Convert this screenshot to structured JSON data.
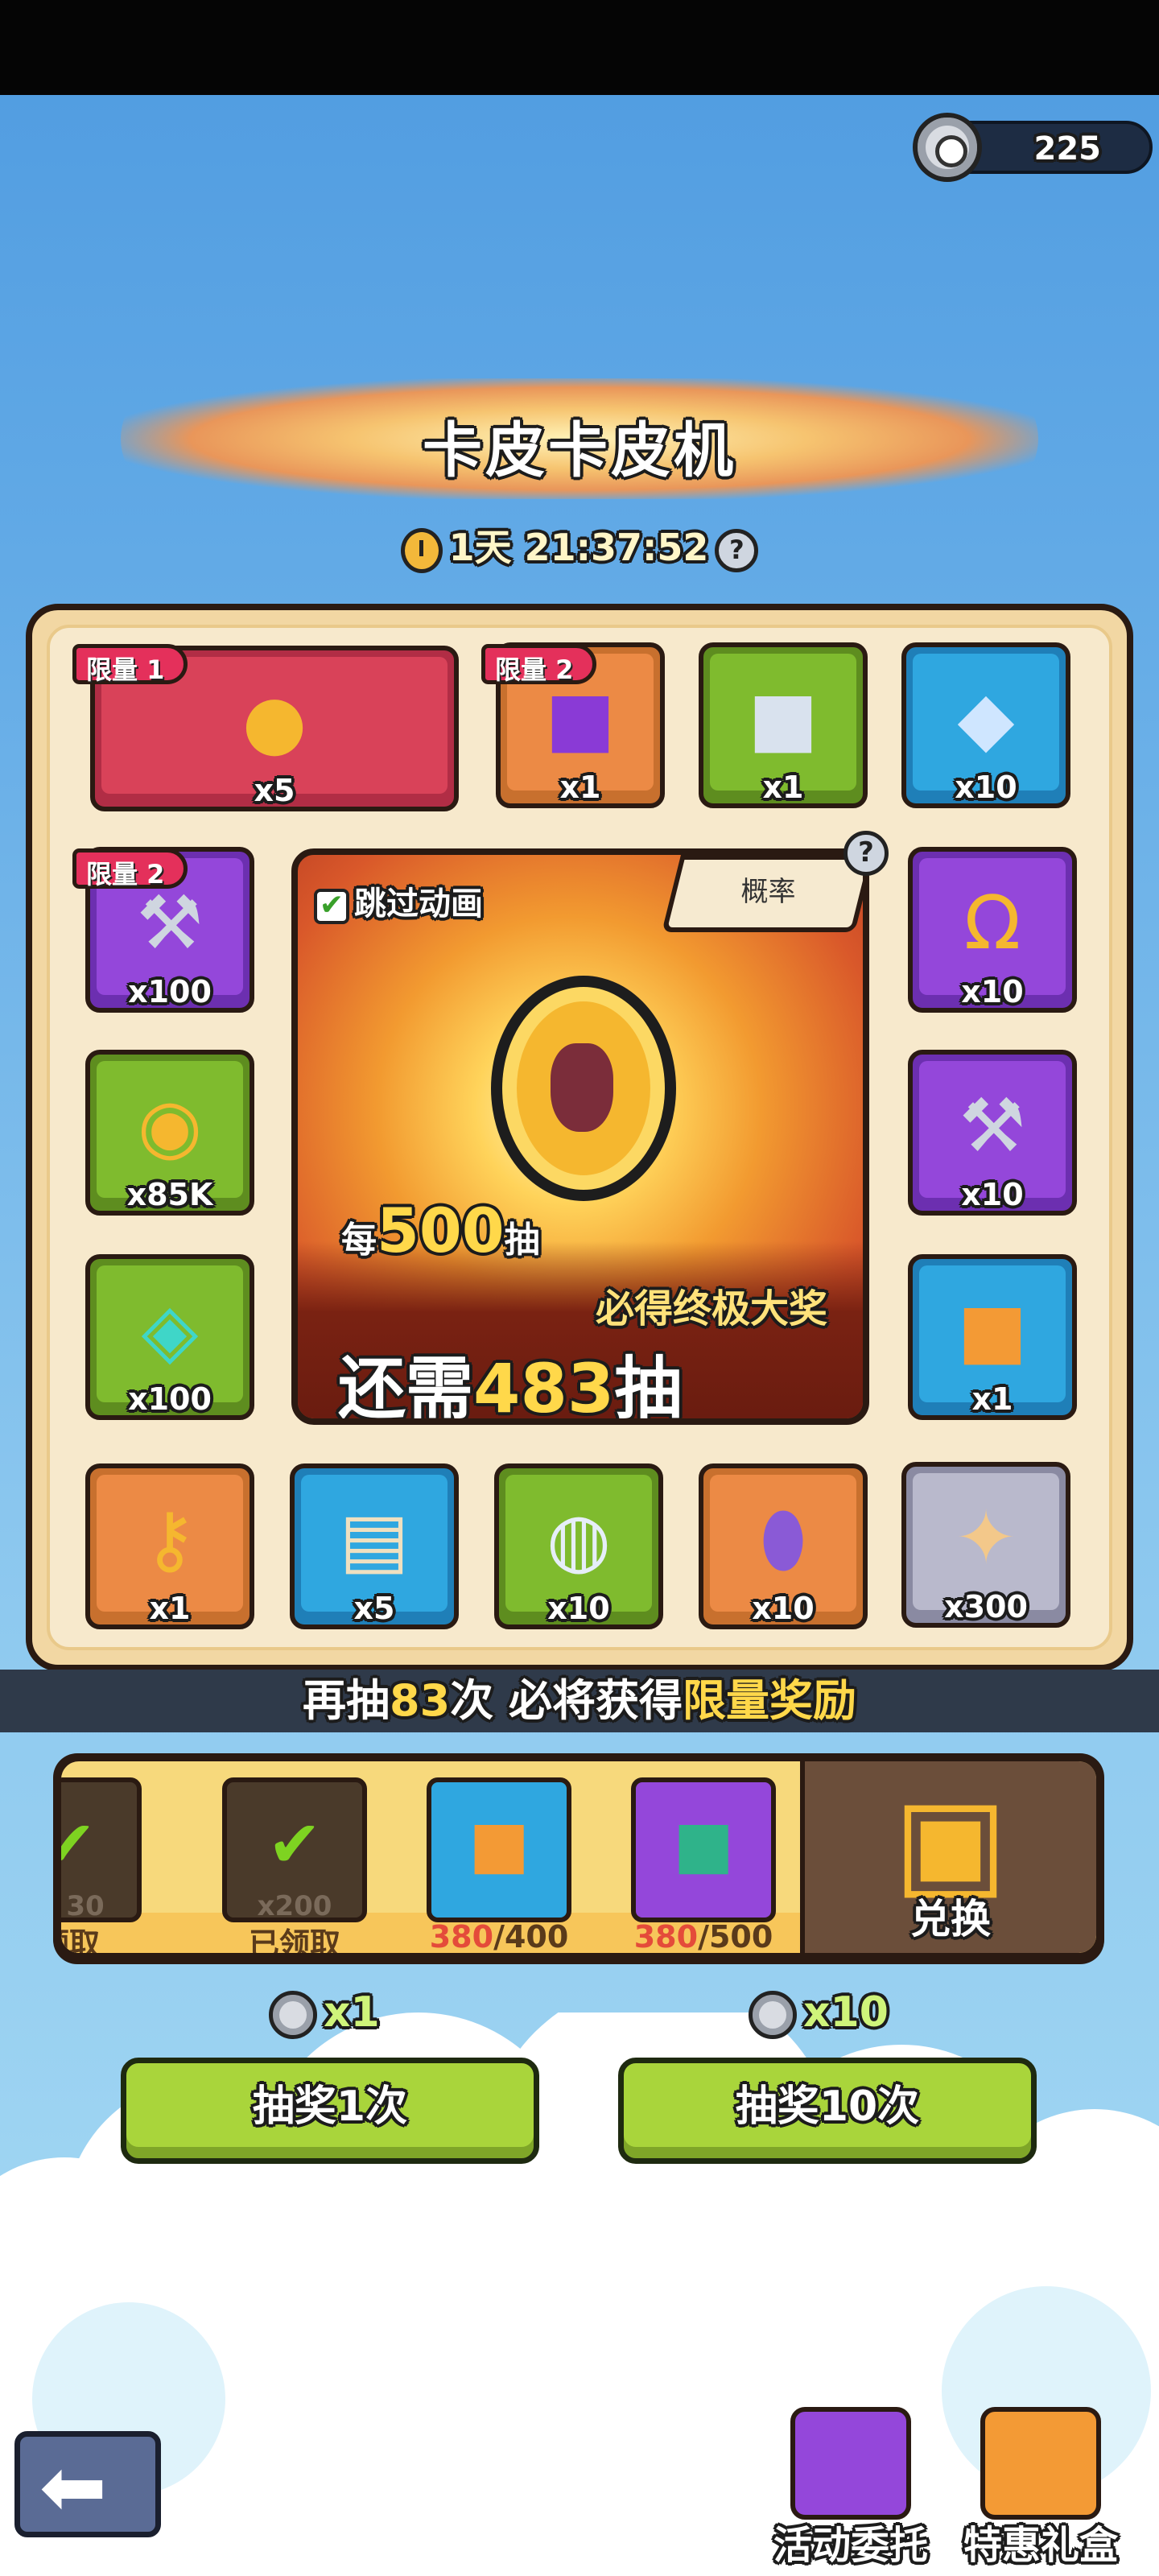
{
  "header": {
    "currency_amount": "225"
  },
  "title": "卡皮卡皮机",
  "timer": "1天 21:37:52",
  "grid": {
    "top_row": [
      {
        "qty": "x5",
        "limit": "限量 1",
        "icon": "capybara-coin"
      },
      {
        "qty": "x1",
        "limit": "限量 2",
        "icon": "purple-gem-chest"
      },
      {
        "qty": "x1",
        "icon": "silver-chest"
      },
      {
        "qty": "x10",
        "icon": "crystal"
      }
    ],
    "left_col": [
      {
        "qty": "x100",
        "limit": "限量 2",
        "icon": "hammer"
      },
      {
        "qty": "x85K",
        "icon": "gold-coin"
      },
      {
        "qty": "x100",
        "icon": "teal-gem"
      }
    ],
    "right_col": [
      {
        "qty": "x10",
        "icon": "horseshoe"
      },
      {
        "qty": "x10",
        "icon": "hammer"
      },
      {
        "qty": "x1",
        "icon": "gold-chest"
      }
    ],
    "bottom_row": [
      {
        "qty": "x1",
        "icon": "key"
      },
      {
        "qty": "x5",
        "icon": "scroll"
      },
      {
        "qty": "x10",
        "icon": "rune-stone"
      },
      {
        "qty": "x10",
        "icon": "egg"
      },
      {
        "qty": "x300",
        "icon": "bone"
      }
    ]
  },
  "jackpot": {
    "skip_label": "跳过动画",
    "prob_label": "概率",
    "every_prefix": "每",
    "every_num": "500",
    "every_suffix": "抽",
    "guarantee": "必得终极大奖",
    "need_prefix": "还需",
    "need_num": "483",
    "need_suffix": "抽"
  },
  "strip": {
    "a": "再抽",
    "b": "83",
    "c": "次 必将获得",
    "d": "限量奖励"
  },
  "track": {
    "items": [
      {
        "label_a": "",
        "label_b": "领取",
        "sub": "30",
        "icon": "check"
      },
      {
        "label_a": "",
        "label_b": "已领取",
        "sub": "x200",
        "icon": "check"
      },
      {
        "label_a": "380",
        "label_b": "/400",
        "icon": "chest"
      },
      {
        "label_a": "380",
        "label_b": "/500",
        "icon": "paw-chest"
      }
    ],
    "exchange_label": "兑换"
  },
  "draw": {
    "one_cost": "x1",
    "ten_cost": "x10",
    "one_label": "抽奖1次",
    "ten_label": "抽奖10次"
  },
  "footer": {
    "task_label": "活动委托",
    "gift_label": "特惠礼盒"
  },
  "colors": {
    "accent_green": "#a9d53b",
    "gold": "#ffd84a",
    "limit_red": "#e4305b"
  }
}
